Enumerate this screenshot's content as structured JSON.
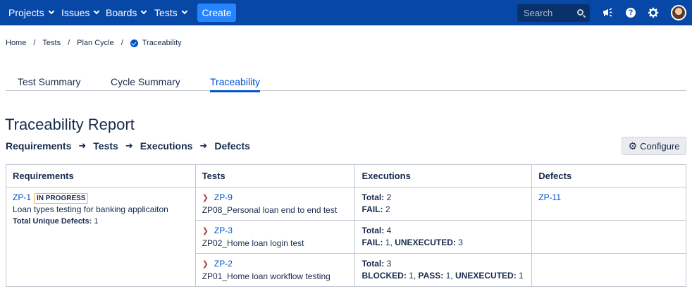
{
  "nav": {
    "items": [
      "Projects",
      "Issues",
      "Boards",
      "Tests"
    ],
    "create_label": "Create",
    "search_placeholder": "Search"
  },
  "breadcrumb": [
    "Home",
    "Tests",
    "Plan Cycle",
    "Traceability"
  ],
  "tabs": [
    "Test Summary",
    "Cycle Summary",
    "Traceability"
  ],
  "active_tab": "Traceability",
  "title": "Traceability Report",
  "flow": [
    "Requirements",
    "Tests",
    "Executions",
    "Defects"
  ],
  "configure_label": "Configure",
  "table": {
    "headers": [
      "Requirements",
      "Tests",
      "Executions",
      "Defects"
    ],
    "requirement": {
      "key": "ZP-1",
      "status": "IN PROGRESS",
      "summary": "Loan types testing for banking applicaiton",
      "defects_label": "Total Unique Defects:",
      "defects_count": "1"
    },
    "rows": [
      {
        "test_key": "ZP-9",
        "test_name": "ZP08_Personal loan end to end test",
        "exec_total_label": "Total:",
        "exec_total": "2",
        "exec_breakdown": [
          {
            "label": "FAIL:",
            "count": "2"
          }
        ],
        "defect": "ZP-11"
      },
      {
        "test_key": "ZP-3",
        "test_name": "ZP02_Home loan login test",
        "exec_total_label": "Total:",
        "exec_total": "4",
        "exec_breakdown": [
          {
            "label": "FAIL:",
            "count": "1"
          },
          {
            "label": "UNEXECUTED:",
            "count": "3"
          }
        ],
        "defect": ""
      },
      {
        "test_key": "ZP-2",
        "test_name": "ZP01_Home loan workflow testing",
        "exec_total_label": "Total:",
        "exec_total": "3",
        "exec_breakdown": [
          {
            "label": "BLOCKED:",
            "count": "1"
          },
          {
            "label": "PASS:",
            "count": "1"
          },
          {
            "label": "UNEXECUTED:",
            "count": "1"
          }
        ],
        "defect": ""
      }
    ]
  },
  "colors": {
    "nav_bg": "#0747a6",
    "create_bg": "#2684ff",
    "link": "#0052cc",
    "lozenge_border": "#f2b74a"
  }
}
